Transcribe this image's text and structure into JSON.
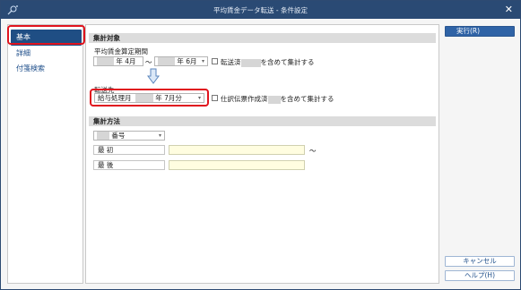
{
  "window": {
    "title": "平均賃金データ転送 - 条件設定",
    "close_glyph": "✕"
  },
  "sidebar": {
    "items": [
      {
        "label": "基本"
      },
      {
        "label": "詳細"
      },
      {
        "label": "付箋検索"
      }
    ]
  },
  "main": {
    "section1_title": "集計対象",
    "period_label": "平均賃金算定期間",
    "period_from_suffix": "年 4月",
    "period_tilde": "〜",
    "period_to_suffix": "年 6月",
    "transferred_label_a": "転送済",
    "transferred_label_b": "を含めて集計する",
    "destination_label": "転送先",
    "destination_prefix": "給与処理月",
    "destination_suffix": "年 7月分",
    "slip_label_a": "仕訳伝票作成済",
    "slip_label_b": "を含めて集計する",
    "section2_title": "集計方法",
    "method_select_suffix": "番号",
    "first_label": "最 初",
    "last_label": "最 後",
    "range_tilde": "〜"
  },
  "buttons": {
    "execute": "実行(R)",
    "cancel": "キャンセル",
    "help": "ヘルプ(H)"
  }
}
